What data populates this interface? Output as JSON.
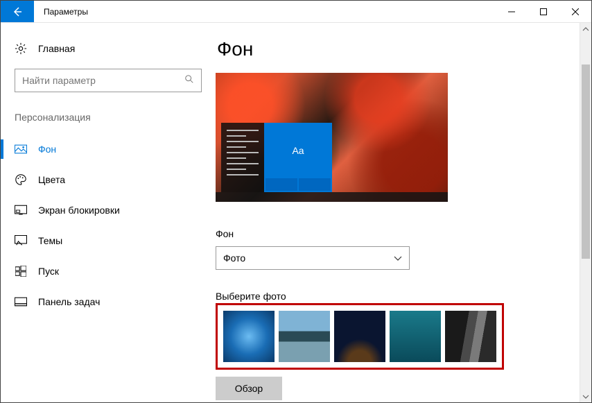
{
  "window": {
    "title": "Параметры"
  },
  "sidebar": {
    "home_label": "Главная",
    "search_placeholder": "Найти параметр",
    "section_title": "Персонализация",
    "items": [
      {
        "label": "Фон",
        "icon": "picture-icon",
        "active": true
      },
      {
        "label": "Цвета",
        "icon": "palette-icon",
        "active": false
      },
      {
        "label": "Экран блокировки",
        "icon": "lockscreen-icon",
        "active": false
      },
      {
        "label": "Темы",
        "icon": "themes-icon",
        "active": false
      },
      {
        "label": "Пуск",
        "icon": "start-icon",
        "active": false
      },
      {
        "label": "Панель задач",
        "icon": "taskbar-icon",
        "active": false
      }
    ]
  },
  "main": {
    "page_title": "Фон",
    "preview_tile_text": "Aa",
    "background_label": "Фон",
    "background_dropdown_value": "Фото",
    "choose_photo_label": "Выберите фото",
    "browse_label": "Обзор"
  }
}
